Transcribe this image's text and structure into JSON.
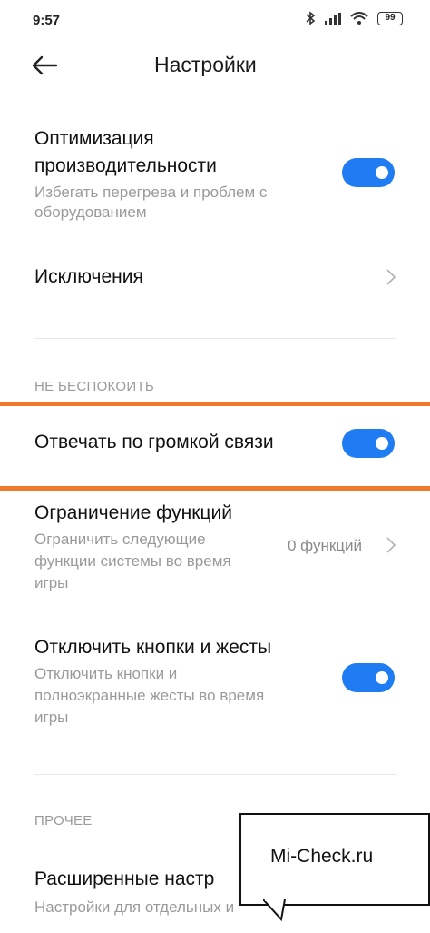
{
  "status_bar": {
    "time": "9:57",
    "battery": "99",
    "icons": [
      "bluetooth-icon",
      "signal-icon",
      "wifi-icon",
      "battery-icon"
    ]
  },
  "header": {
    "title": "Настройки",
    "back_icon": "arrow-left-icon"
  },
  "settings": {
    "performance": {
      "title_line1": "Оптимизация",
      "title_line2": "производительности",
      "sub_line1": "Избегать перегрева и проблем с",
      "sub_line2": "оборудованием",
      "enabled": true
    },
    "exceptions": {
      "title": "Исключения"
    },
    "dnd_section": "НЕ БЕСПОКОИТЬ",
    "speaker_answer": {
      "title": "Отвечать по громкой связи",
      "enabled": true
    },
    "restrict_functions": {
      "title": "Ограничение функций",
      "sub_line1": "Ограничить следующие",
      "sub_line2": "функции системы во время",
      "sub_line3": "игры",
      "value": "0 функций"
    },
    "disable_buttons": {
      "title": "Отключить кнопки и жесты",
      "sub_line1": "Отключить кнопки и",
      "sub_line2": "полноэкранные жесты во время",
      "sub_line3": "игры",
      "enabled": true
    },
    "other_section": "ПРОЧЕЕ",
    "advanced": {
      "title": "Расширенные настр",
      "sub": "Настройки для отдельных и"
    }
  },
  "watermark": {
    "text": "Mi-Check.ru"
  },
  "colors": {
    "toggle_on": "#1f7cf2",
    "highlight": "#f07a2c",
    "secondary_text": "#9a9a9a"
  }
}
